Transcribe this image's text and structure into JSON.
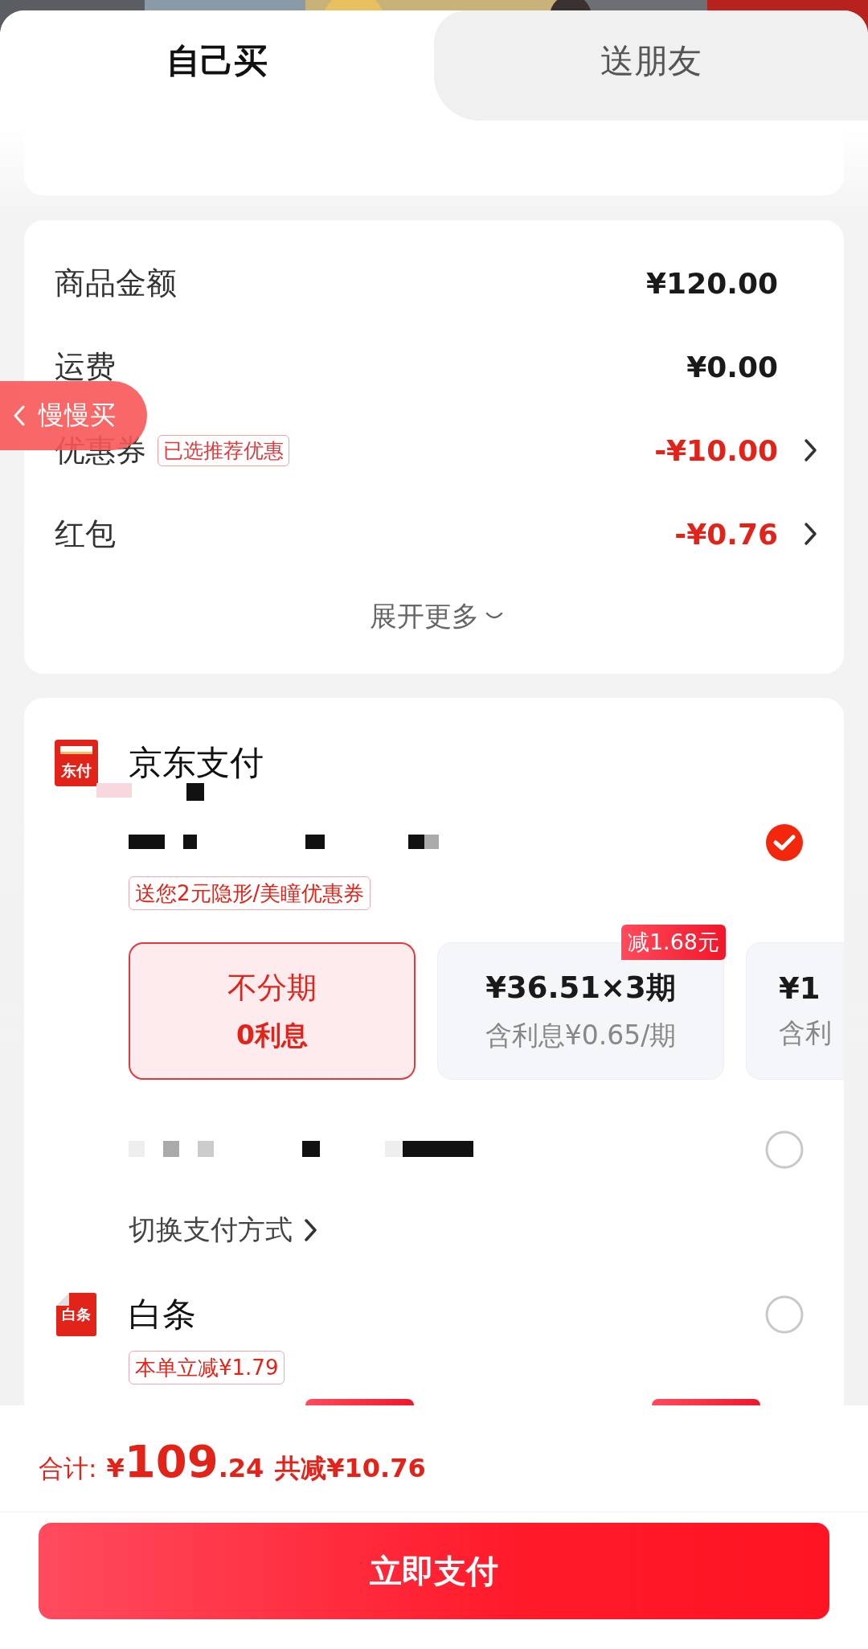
{
  "tabs": [
    {
      "label": "自己买",
      "selected": true
    },
    {
      "label": "送朋友",
      "selected": false
    }
  ],
  "summary": {
    "rows": [
      {
        "label": "商品金额",
        "value": "¥120.00",
        "kind": "plain"
      },
      {
        "label": "运费",
        "value": "¥0.00",
        "kind": "plain"
      },
      {
        "label": "优惠券",
        "tag": "已选推荐优惠",
        "value": "-¥10.00",
        "kind": "discount"
      },
      {
        "label": "红包",
        "value": "-¥0.76",
        "kind": "discount"
      }
    ],
    "expand": "展开更多"
  },
  "floating_button": {
    "label": "慢慢买"
  },
  "payment": {
    "jd_pay": {
      "title": "京东支付",
      "logo_text": "东付",
      "options": [
        {
          "selected": true,
          "promo": "送您2元隐形/美瞳优惠券",
          "installments": [
            {
              "title": "不分期",
              "subtitle": "0利息",
              "selected": true
            },
            {
              "title": "¥36.51×3期",
              "subtitle": "含利息¥0.65/期",
              "badge": "减1.68元",
              "selected": false
            },
            {
              "title": "¥1",
              "subtitle": "含利",
              "selected": false
            }
          ]
        },
        {
          "selected": false
        }
      ],
      "switch_link": "切换支付方式"
    },
    "baitiao": {
      "title": "白条",
      "logo_text": "白条",
      "selected": false,
      "promo": "本单立减¥1.79"
    }
  },
  "footer": {
    "total_label": "合计:",
    "currency": "¥",
    "total_integer": "109",
    "total_decimal": ".24",
    "saved": "共减¥10.76",
    "pay_button": "立即支付"
  }
}
